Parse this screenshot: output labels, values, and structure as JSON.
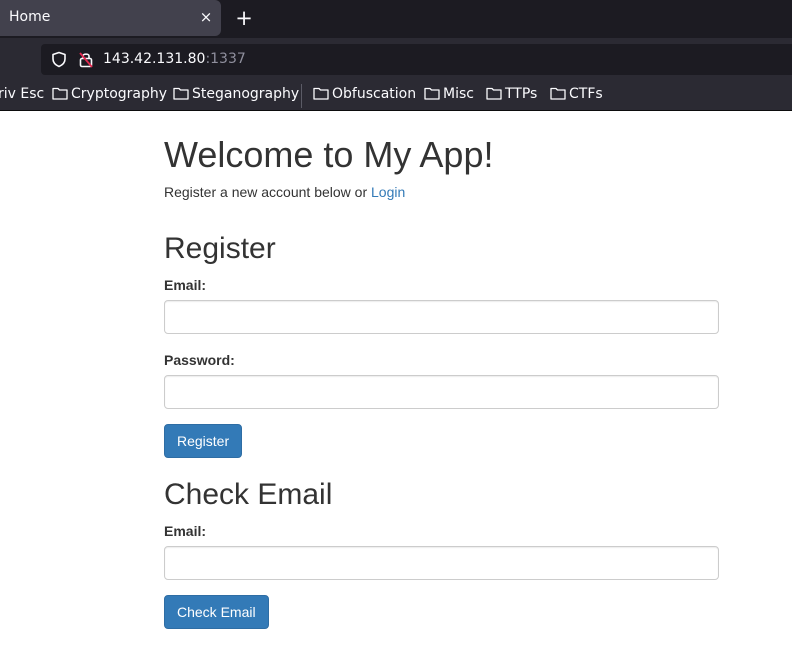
{
  "browser": {
    "tab": {
      "title": "Home",
      "close_symbol": "×"
    },
    "new_tab_symbol": "+",
    "url": {
      "host": "143.42.131.80",
      "port": ":1337"
    },
    "bookmarks": [
      "riv Esc",
      "Cryptography",
      "Steganography",
      "Obfuscation",
      "Misc",
      "TTPs",
      "CTFs"
    ]
  },
  "page": {
    "title": "Welcome to My App!",
    "subtitle_text": "Register a new account below or ",
    "login_link": "Login",
    "register": {
      "heading": "Register",
      "email_label": "Email:",
      "email_value": "",
      "password_label": "Password:",
      "password_value": "",
      "button": "Register"
    },
    "check_email": {
      "heading": "Check Email",
      "email_label": "Email:",
      "email_value": "",
      "button": "Check Email"
    }
  },
  "colors": {
    "link": "#337ab7",
    "button_bg": "#337ab7",
    "text": "#333333",
    "chrome_dark": "#1c1b22",
    "chrome": "#2b2a33"
  }
}
